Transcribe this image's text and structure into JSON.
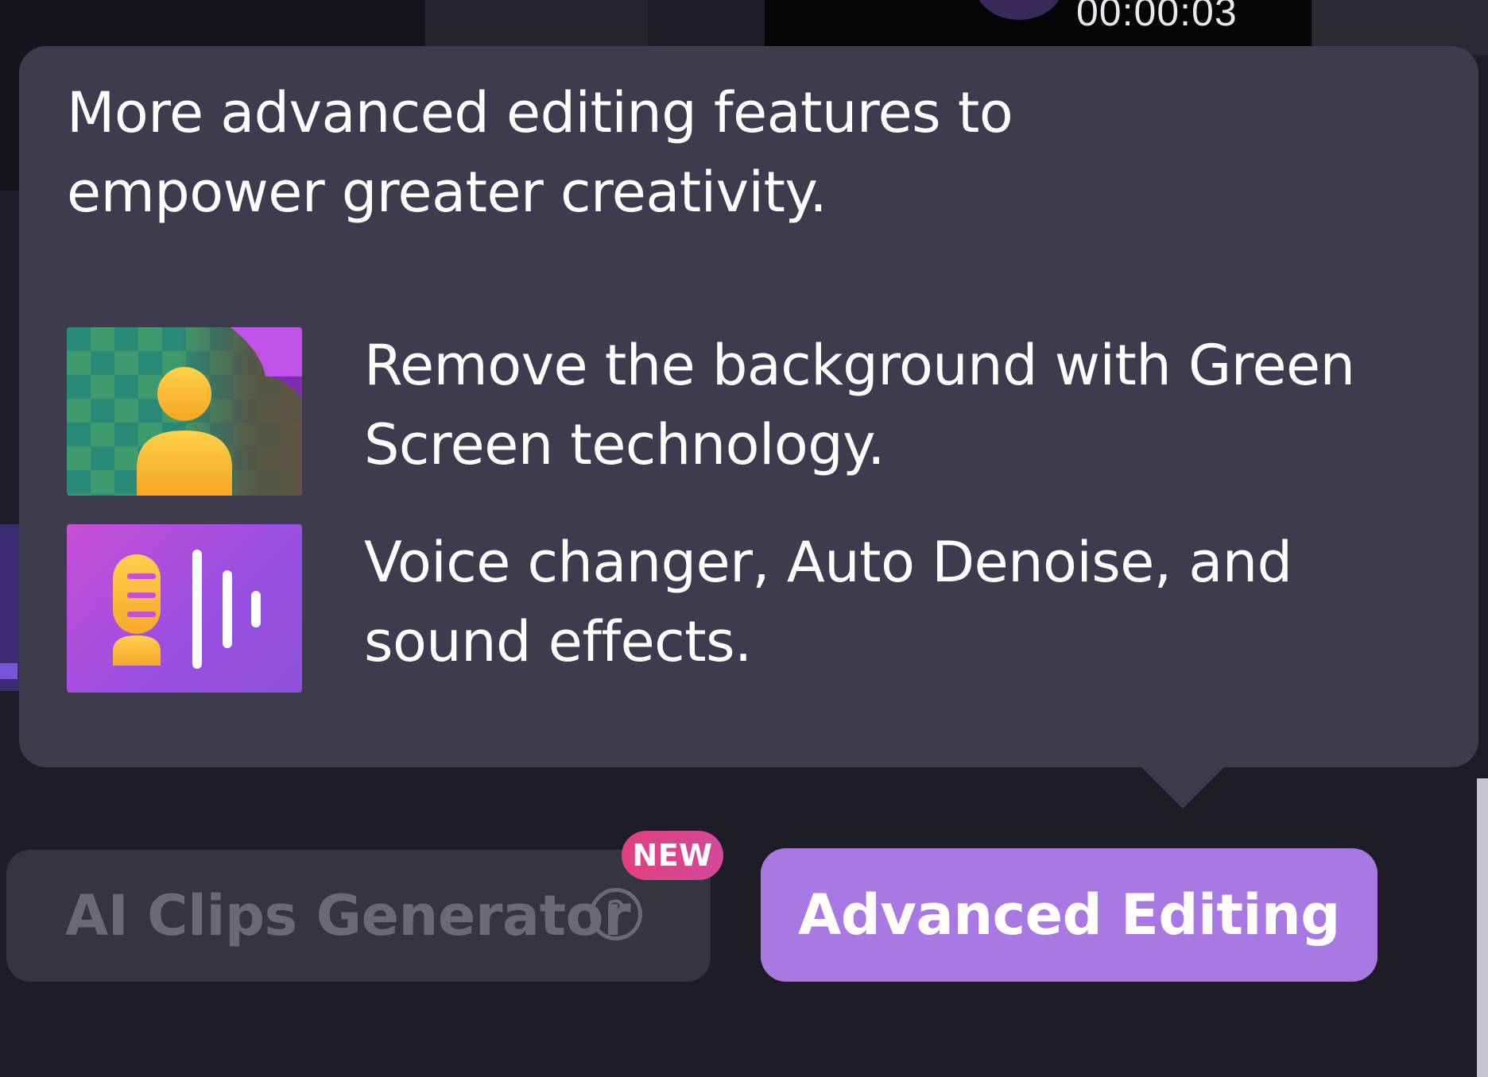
{
  "video_preview": {
    "timecode": "00:00:03"
  },
  "popover": {
    "title": "More advanced editing features to empower greater creativity.",
    "features": [
      {
        "icon": "green-screen-icon",
        "text": "Remove the background with Green Screen technology."
      },
      {
        "icon": "voice-changer-icon",
        "text": "Voice changer, Auto Denoise, and sound effects."
      }
    ]
  },
  "buttons": {
    "ai_clips_label": "AI Clips Generator",
    "help_glyph": "?",
    "new_badge": "NEW",
    "advanced_editing_label": "Advanced Editing"
  },
  "colors": {
    "popover_bg": "#3f3b4e",
    "accent": "#a879e3",
    "badge": "#e0407e",
    "disabled_text": "#6c6975"
  }
}
